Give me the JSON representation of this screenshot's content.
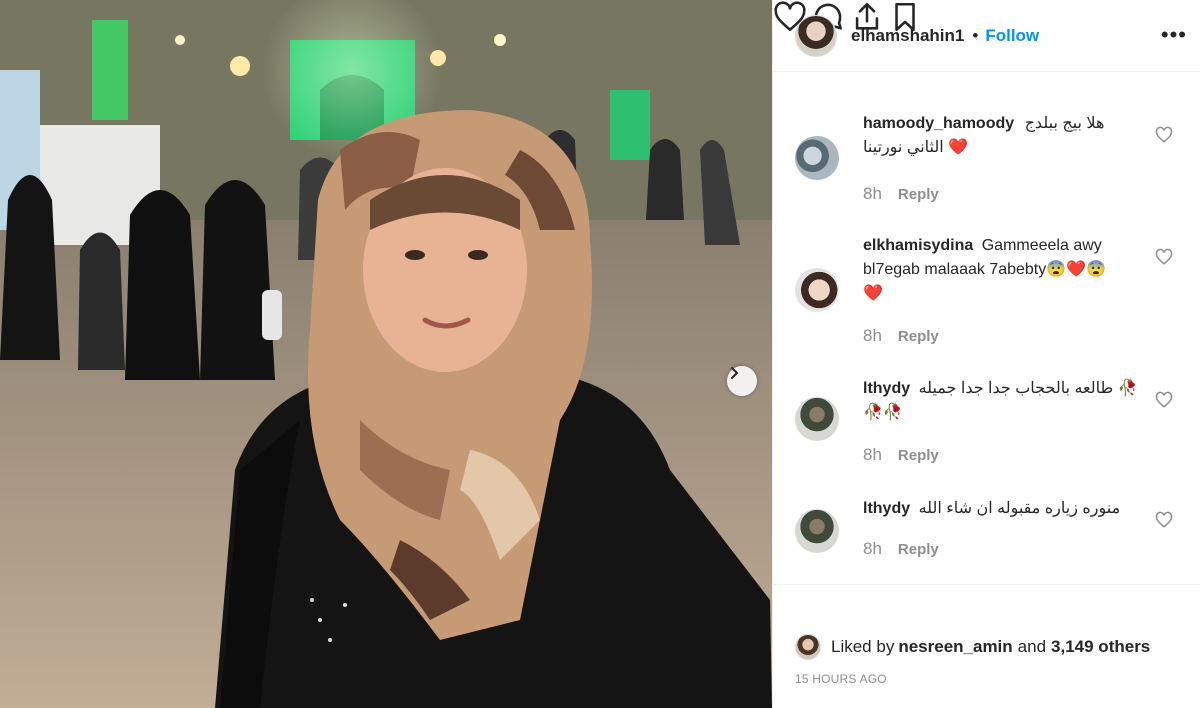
{
  "post": {
    "username": "elhamshahin1",
    "dot": "•",
    "follow_label": "Follow",
    "more_label": "•••"
  },
  "comments": [
    {
      "username": "hamoody_hamoody",
      "text_line1": "هلا بيج ببلدج",
      "text_line2": "الثاني نورتينا ❤️",
      "time": "8h",
      "reply_label": "Reply"
    },
    {
      "username": "elkhamisydina",
      "text_line1": "Gammeeela awy",
      "text_line2": "bl7egab malaaak 7abebty😨❤️😨",
      "text_line3": "❤️",
      "time": "8h",
      "reply_label": "Reply"
    },
    {
      "username": "lthydy",
      "text_line1": "طالعه بالحجاب جدا جدا جميله 🥀",
      "text_line2": "🥀🥀",
      "time": "8h",
      "reply_label": "Reply"
    },
    {
      "username": "lthydy",
      "text_line1": "منوره زياره مقبوله ان شاء الله",
      "time": "8h",
      "reply_label": "Reply"
    }
  ],
  "likes": {
    "prefix": "Liked by",
    "user": "nesreen_amin",
    "and": "and",
    "others": "3,149 others"
  },
  "timestamp": "15 HOURS AGO",
  "icons": [
    "chevron-right-icon",
    "heart-icon",
    "comment-icon",
    "share-icon",
    "bookmark-icon"
  ],
  "colors": {
    "accent": "#0095f6",
    "muted": "#8e8e8e",
    "text": "#262626"
  }
}
